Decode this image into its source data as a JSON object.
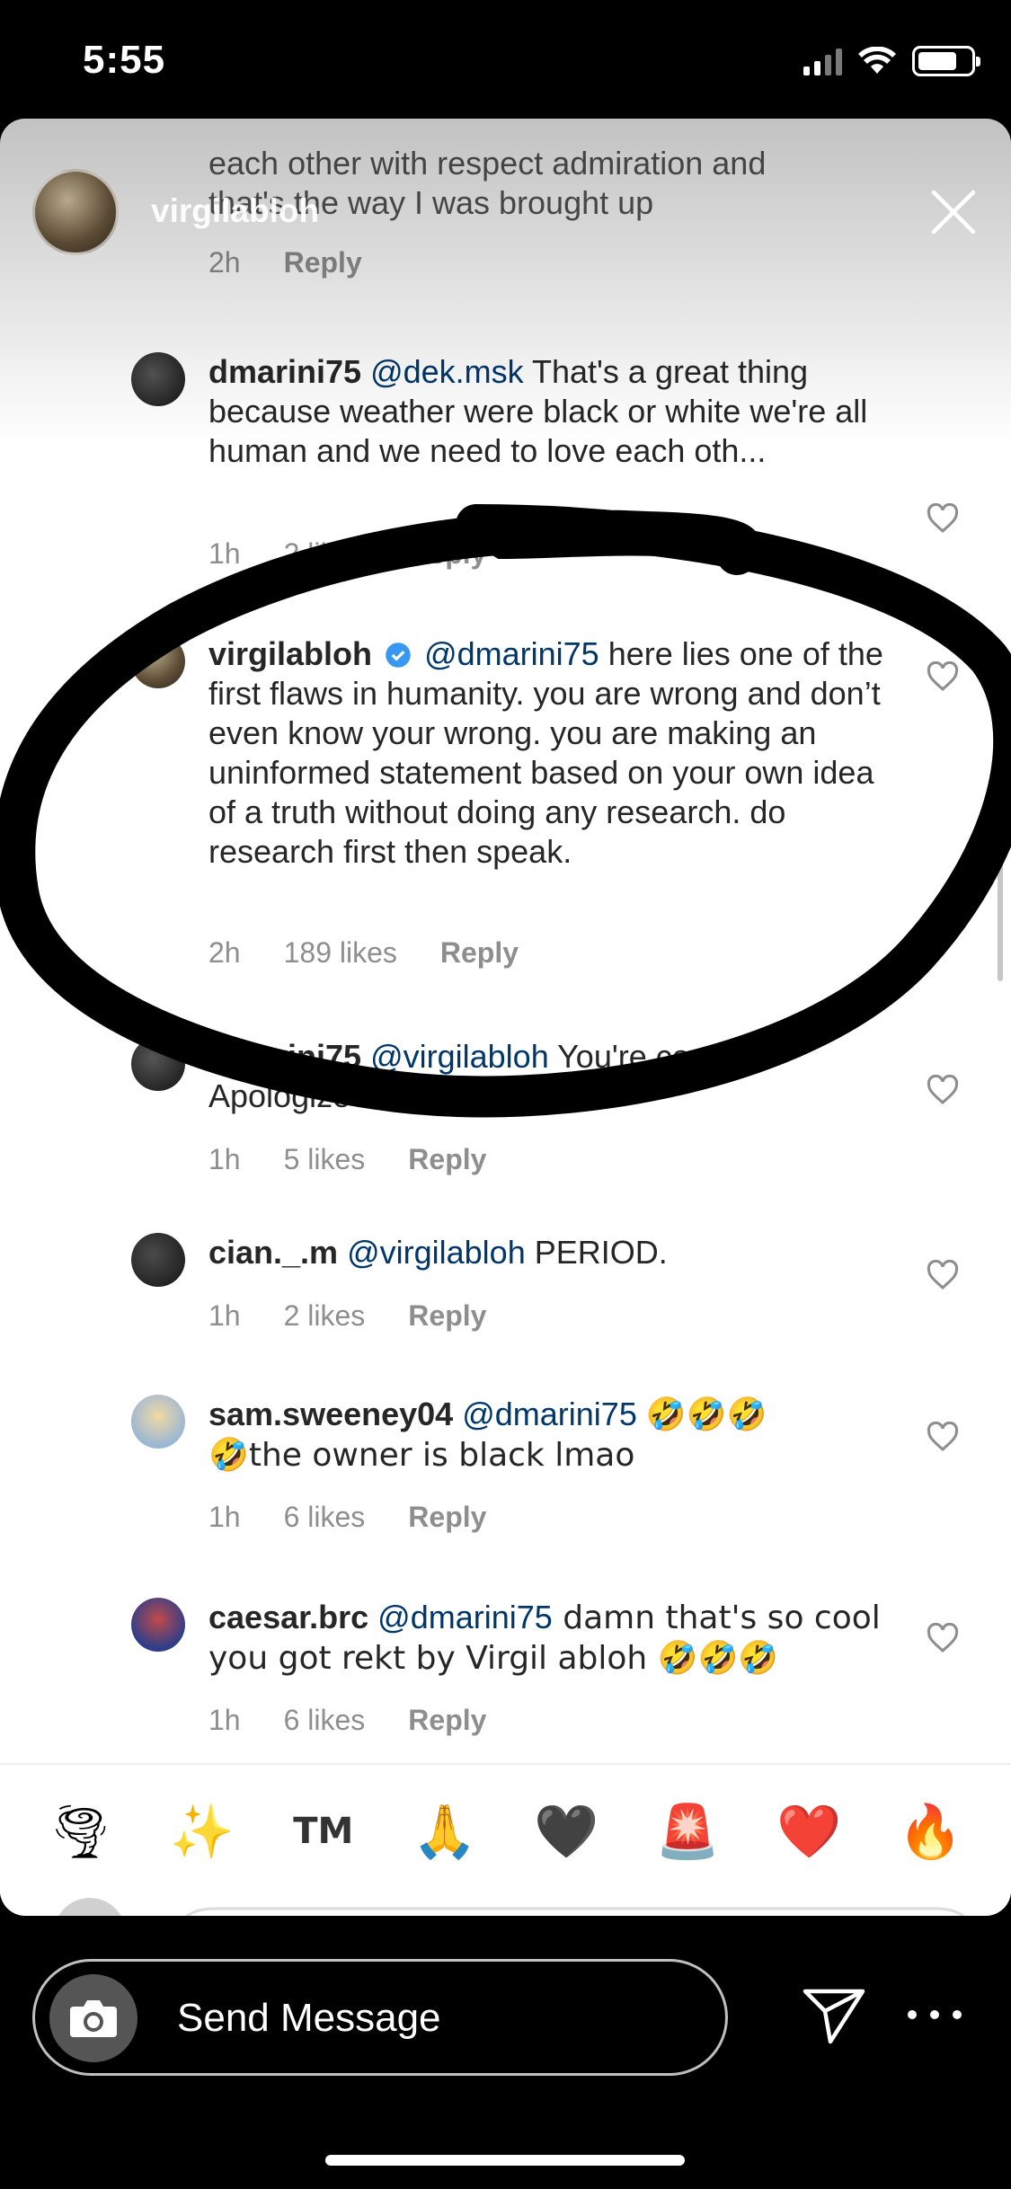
{
  "status_bar": {
    "time": "5:55"
  },
  "story": {
    "username": "virgilabloh"
  },
  "top_comment": {
    "text_line1": "each other with respect admiration and",
    "text_line2": "that's the way I was brought up",
    "time": "2h",
    "reply": "Reply"
  },
  "comments": [
    {
      "user": "dmarini75",
      "mention": "@dek.msk",
      "text": " That's a great thing because weather were black or white we're all human and we need to love each oth...",
      "time": "1h",
      "likes": "2 likes",
      "reply": "Reply"
    },
    {
      "user": "virgilabloh",
      "mention": "@dmarini75",
      "text": " here lies one of the first flaws in humanity. you are wrong and don’t even know your wrong. you are making an uninformed statement based on your own idea of a truth without doing any research. do research first then speak.",
      "time": "2h",
      "likes": "189 likes",
      "reply": "Reply"
    },
    {
      "user": "dmarini75",
      "mention": "@virgilabloh",
      "text": "  You're correct. Apologize",
      "time": "1h",
      "likes": "5 likes",
      "reply": "Reply"
    },
    {
      "user": "cian._.m",
      "mention": "@virgilabloh",
      "text": " PERIOD.",
      "time": "1h",
      "likes": "2 likes",
      "reply": "Reply"
    },
    {
      "user": "sam.sweeney04",
      "mention": "@dmarini75",
      "emoji": "🤣🤣🤣",
      "text": "🤣the owner is black lmao",
      "time": "1h",
      "likes": "6 likes",
      "reply": "Reply"
    },
    {
      "user": "caesar.brc",
      "mention": "@dmarini75",
      "text": " damn that's so cool you got rekt by Virgil abloh 🤣🤣🤣",
      "time": "1h",
      "likes": "6 likes",
      "reply": "Reply"
    }
  ],
  "emoji_bar": [
    "🌪",
    "✨",
    "TM",
    "🙏",
    "🖤",
    "🚨",
    "❤️",
    "🔥"
  ],
  "bottom_bar": {
    "placeholder": "Send Message"
  },
  "colors": {
    "mention": "#00376b",
    "meta": "#8e8e8e",
    "text": "#262626"
  },
  "icons": [
    "close-icon",
    "heart-icon",
    "verified-icon",
    "camera-icon",
    "send-icon",
    "more-icon",
    "signal-icon",
    "wifi-icon",
    "battery-icon"
  ]
}
